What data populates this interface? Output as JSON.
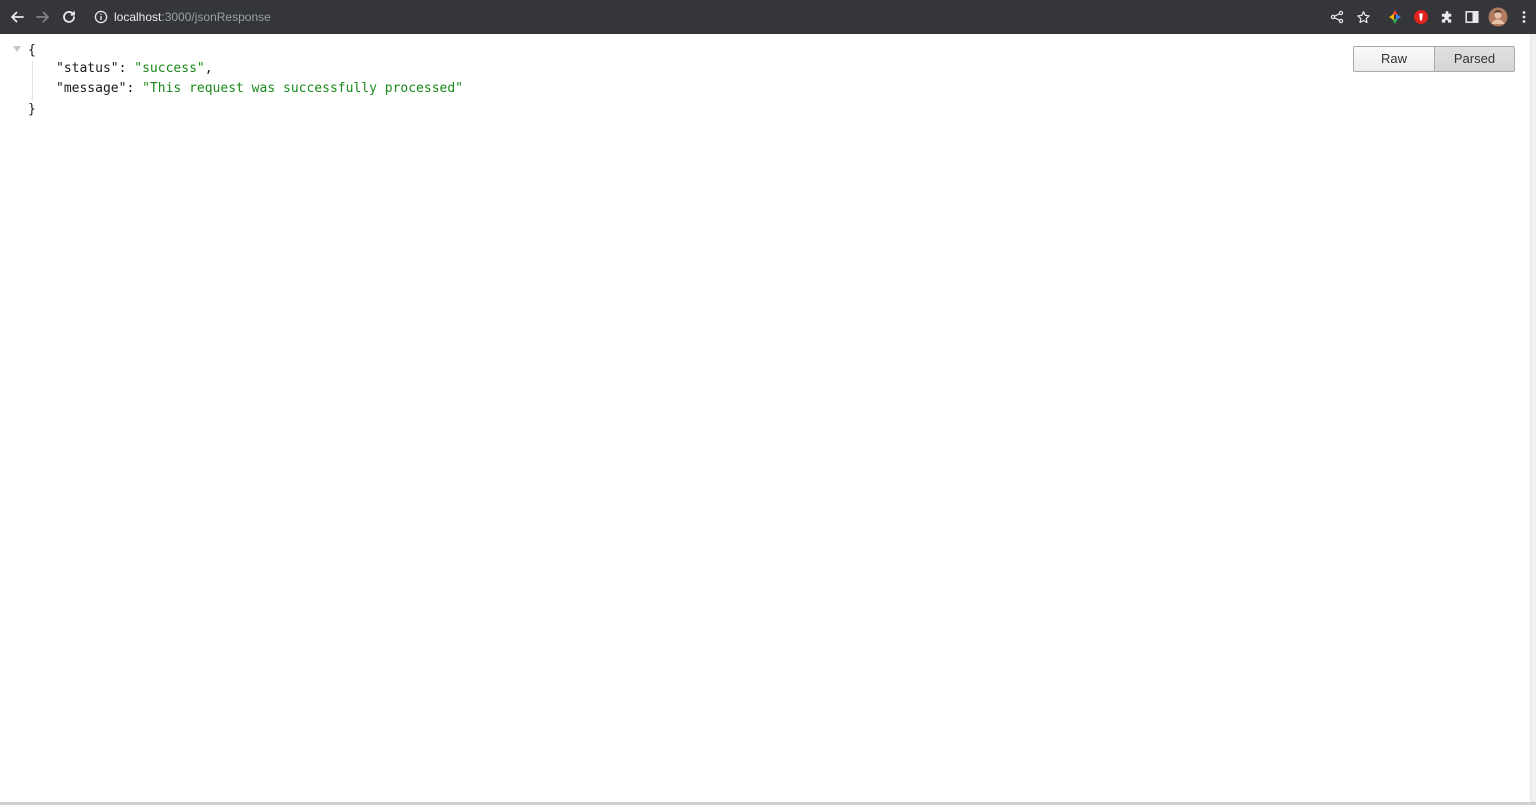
{
  "browser": {
    "url_host": "localhost",
    "url_path": ":3000/jsonResponse",
    "icons": [
      "back-icon",
      "forward-icon",
      "reload-icon",
      "site-info-icon",
      "share-icon",
      "bookmark-star-icon",
      "color-extension-icon",
      "red-extension-icon",
      "puzzle-extensions-icon",
      "side-panel-icon",
      "profile-avatar",
      "more-menu-icon"
    ]
  },
  "json_viewer": {
    "open_brace": "{",
    "close_brace": "}",
    "entries": [
      {
        "key": "\"status\"",
        "sep": ": ",
        "value": "\"success\"",
        "trail": ","
      },
      {
        "key": "\"message\"",
        "sep": ": ",
        "value": "\"This request was successfully processed\"",
        "trail": ""
      }
    ],
    "string_color": "#1a8a1a"
  },
  "view_toggle": {
    "raw_label": "Raw",
    "parsed_label": "Parsed",
    "selected": "Parsed"
  }
}
